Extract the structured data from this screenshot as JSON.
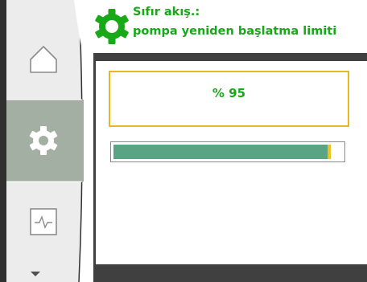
{
  "header": {
    "icon": "gear-icon",
    "title": "Sıfır akış.:",
    "subtitle": "pompa yeniden başlatma limiti"
  },
  "nav": {
    "items": [
      {
        "name": "home",
        "icon": "house-icon",
        "selected": false
      },
      {
        "name": "settings",
        "icon": "gear-icon",
        "selected": true
      },
      {
        "name": "monitor",
        "icon": "pulse-icon",
        "selected": false
      }
    ],
    "more_icon": "triangle-down-icon"
  },
  "value": {
    "display": "% 95",
    "percent": 95
  },
  "colors": {
    "accent_green": "#18a818",
    "selection_yellow": "#e8b820",
    "progress_fill": "#5aa383",
    "nav_selected": "#a4afa4"
  }
}
